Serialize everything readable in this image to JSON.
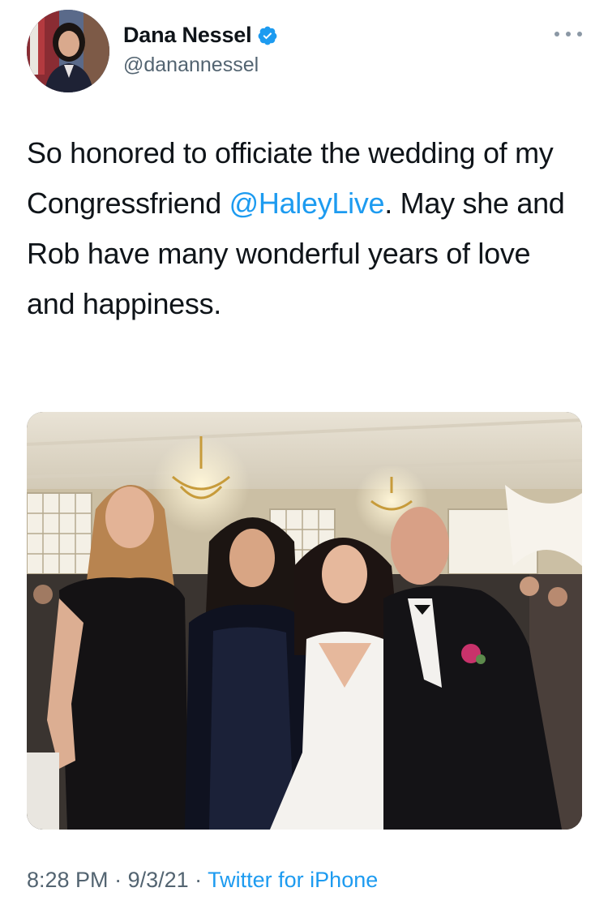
{
  "author": {
    "display_name": "Dana Nessel",
    "handle": "@danannessel",
    "verified": true,
    "avatar_icon": "profile-photo"
  },
  "tweet": {
    "text_before_mention": "So honored to officiate the wedding of my Congressfriend ",
    "mention": "@HaleyLive",
    "text_after_mention": ". May she and Rob have many wonderful years of love and happiness."
  },
  "media": {
    "type": "photo",
    "icon": "wedding-photo"
  },
  "meta": {
    "time": "8:28 PM",
    "separator_1": " · ",
    "date": "9/3/21",
    "separator_2": " · ",
    "source": "Twitter for iPhone"
  },
  "colors": {
    "link": "#1d9bf0",
    "secondary_text": "#536471",
    "verified_badge": "#1d9bf0"
  },
  "icons": {
    "more": "more-horizontal-icon",
    "verified": "verified-badge-icon"
  }
}
